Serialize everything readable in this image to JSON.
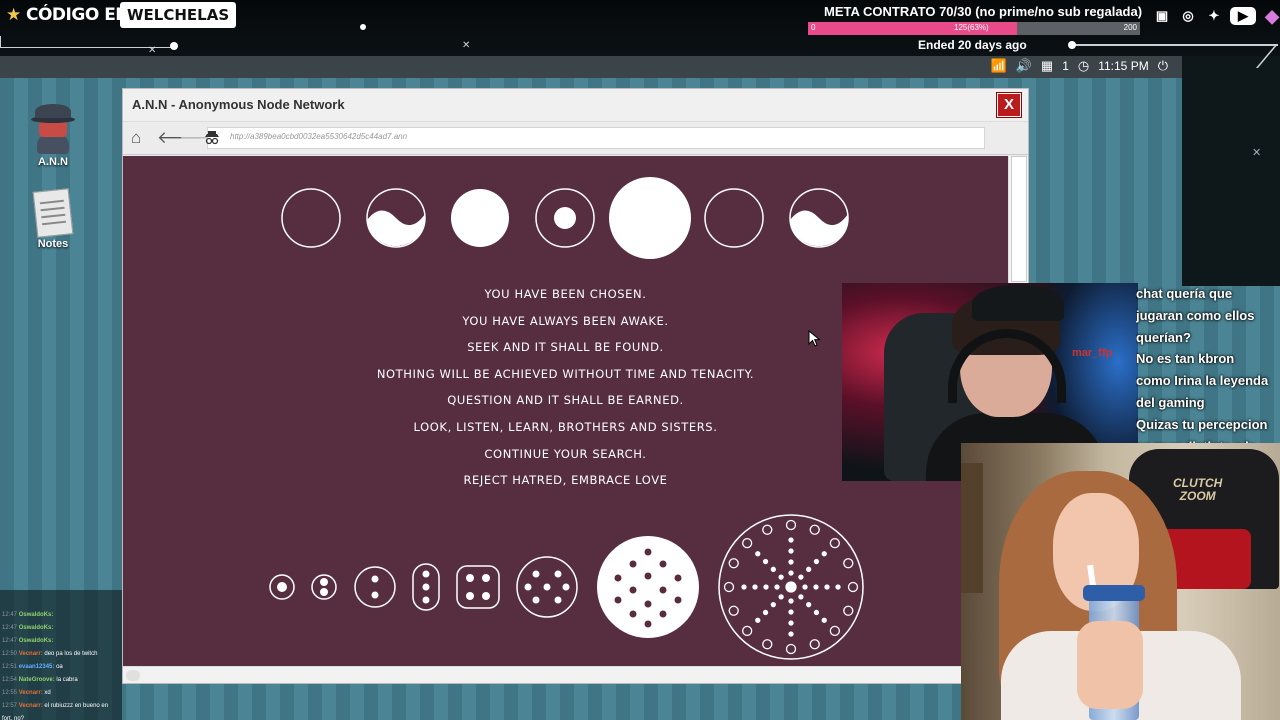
{
  "overlay": {
    "brand": "CÓDIGO EPIC",
    "brand_tag": "WELCHELAS",
    "meta": {
      "title": "META CONTRATO 70/30 (no prime/no sub regalada)",
      "start": "0",
      "progress_label": "125(63%)",
      "end": "200",
      "progress": 0.63,
      "ended": "Ended 20 days ago"
    },
    "socials": [
      "twitch-icon",
      "instagram-icon",
      "twitter-icon",
      "youtube-icon",
      "gem-icon"
    ]
  },
  "taskbar": {
    "notifications": "1",
    "clock": "11:15 PM"
  },
  "desktop": {
    "icons": [
      {
        "label": "A.N.N"
      },
      {
        "label": "Notes"
      }
    ]
  },
  "browser": {
    "title": "A.N.N - Anonymous Node Network",
    "close": "X",
    "url": "http://a389bea0cbd0032ea5530642d5c44ad7.ann",
    "messages": [
      "YOU HAVE BEEN CHOSEN.",
      "YOU HAVE ALWAYS BEEN AWAKE.",
      "SEEK AND IT SHALL BE FOUND.",
      "NOTHING WILL BE ACHIEVED WITHOUT TIME AND TENACITY.",
      "QUESTION AND IT SHALL BE EARNED.",
      "LOOK, LISTEN, LEARN, BROTHERS AND SISTERS.",
      "CONTINUE YOUR SEARCH.",
      "REJECT HATRED, EMBRACE LOVE"
    ],
    "colors": {
      "page_bg": "#562e40",
      "glyph": "#ffffff"
    }
  },
  "stream_caption": [
    "chat quería que",
    "jugaran como ellos",
    "querían?",
    "No es tan kbron",
    "como Irina la leyenda",
    "del gaming",
    "Quizas tu percepcion",
    "es muy distinta a la"
  ],
  "webcam_overlay_name": "mar_ffp",
  "chat": [
    {
      "time": "12:47",
      "user": "OswaldoKs:",
      "msg": ""
    },
    {
      "time": "12:47",
      "user": "OswaldoKs:",
      "msg": ""
    },
    {
      "time": "12:47",
      "user": "OswaldoKs:",
      "msg": ""
    },
    {
      "time": "12:50",
      "user": "Vecnarr:",
      "msg": "deo pa los de twitch"
    },
    {
      "time": "12:51",
      "user": "evaan12345:",
      "msg": "oa"
    },
    {
      "time": "12:54",
      "user": "NateGroove:",
      "msg": "la cabra"
    },
    {
      "time": "12:55",
      "user": "Vecnarr:",
      "msg": "xd"
    },
    {
      "time": "12:57",
      "user": "Vecnarr:",
      "msg": "el rubiuzzz en bueno en"
    },
    {
      "time": "",
      "user": "",
      "msg": "fort, no?"
    }
  ]
}
